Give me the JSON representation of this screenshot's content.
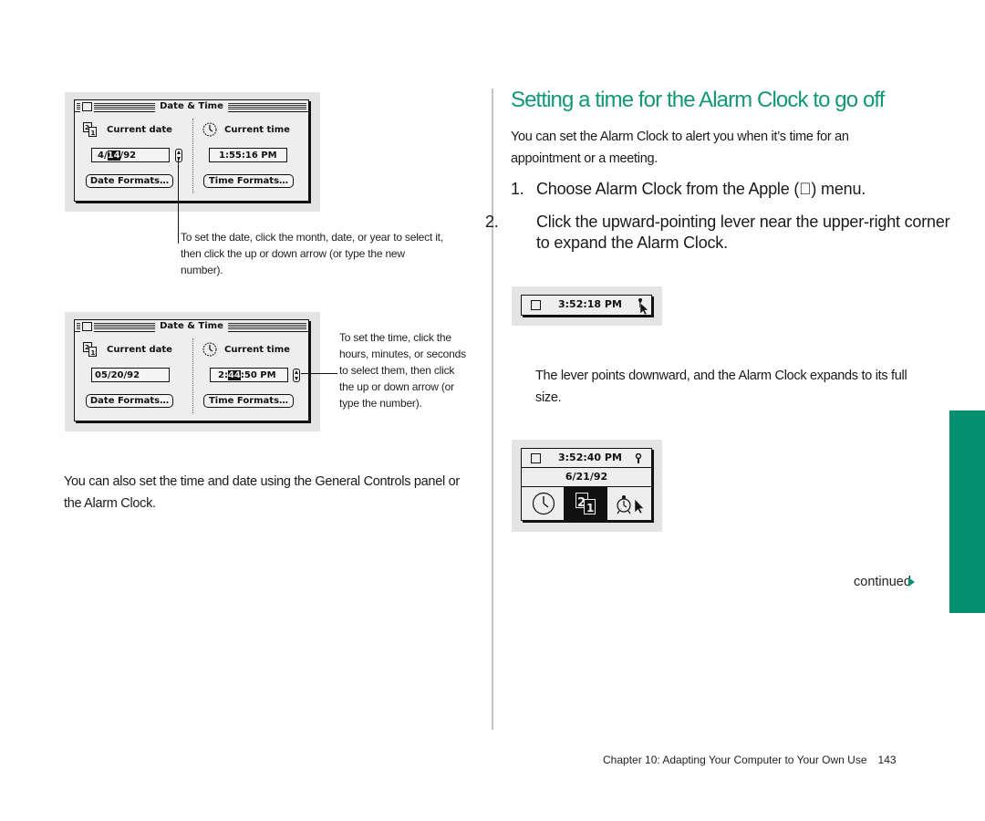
{
  "colors": {
    "accent": "#119877",
    "tab": "#029070"
  },
  "left": {
    "window1": {
      "title": "Date & Time",
      "current_date_label": "Current date",
      "current_time_label": "Current time",
      "date_value_pre": "4/",
      "date_value_sel": "14",
      "date_value_post": "/92",
      "time_value": "1:55:16 PM",
      "date_formats_button": "Date Formats…",
      "time_formats_button": "Time Formats…"
    },
    "caption1": "To set the date, click the month, date, or year to select it, then click the up or down arrow (or type the new number).",
    "window2": {
      "title": "Date & Time",
      "current_date_label": "Current date",
      "current_time_label": "Current time",
      "date_value": "05/20/92",
      "time_value_pre": "2:",
      "time_value_sel": "44",
      "time_value_post": ":50 PM",
      "date_formats_button": "Date Formats…",
      "time_formats_button": "Time Formats…"
    },
    "caption2": "To set the time, click the hours, minutes, or seconds to select them, then click the up or down arrow (or type the number).",
    "paragraph": "You can also set the time and date using the General Controls panel or the Alarm Clock."
  },
  "right": {
    "heading": "Setting a time for the Alarm Clock to go off",
    "intro": "You can set the Alarm Clock to alert you when it’s time for an appointment or a meeting.",
    "steps": [
      {
        "num": "1.",
        "text": "Choose Alarm Clock from the Apple () menu."
      },
      {
        "num": "2.",
        "text": "Click the upward-pointing lever near the upper-right corner to expand the Alarm Clock."
      }
    ],
    "alarm_small": {
      "time": "3:52:18 PM"
    },
    "result_text": "The lever points downward, and the Alarm Clock expands to its full size.",
    "alarm_full": {
      "time": "3:52:40 PM",
      "date": "6/21/92"
    },
    "continued": "continued"
  },
  "footer": {
    "chapter": "Chapter 10:  Adapting Your Computer to Your Own Use",
    "page": "143"
  }
}
